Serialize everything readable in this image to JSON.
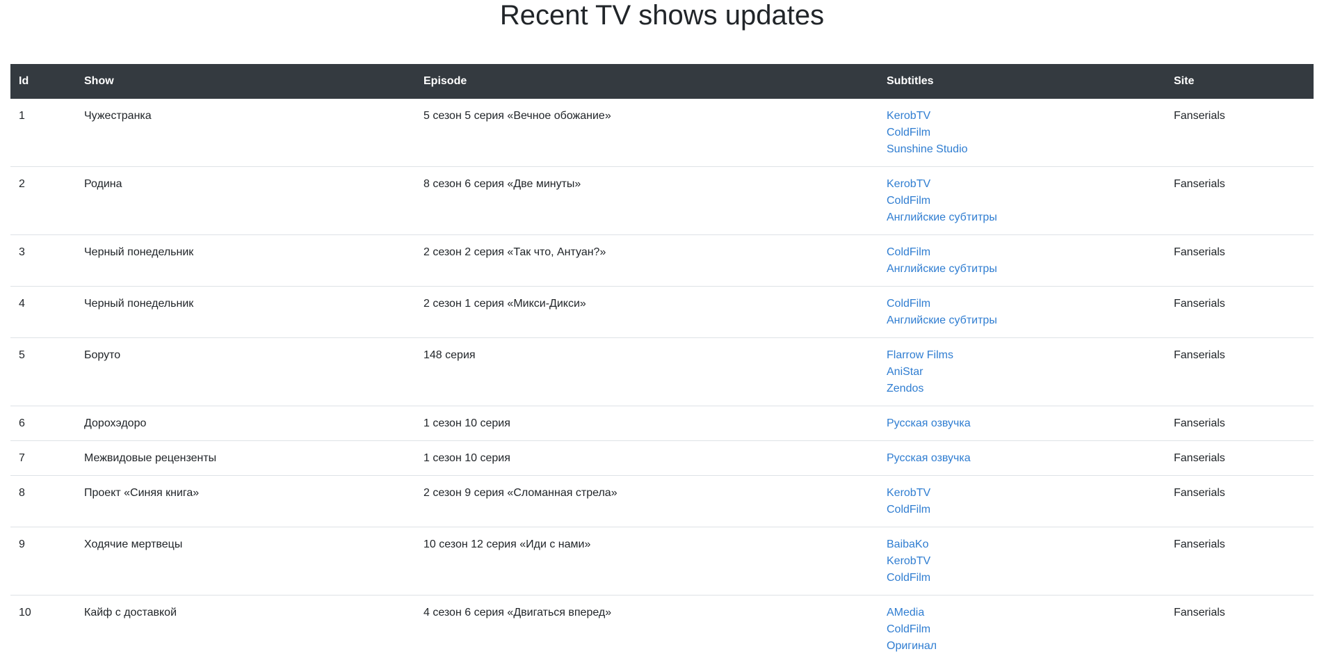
{
  "page": {
    "title": "Recent TV shows updates"
  },
  "colors": {
    "header_bg": "#343a40",
    "link": "#2f7dd1",
    "text": "#212529",
    "row_divider": "#dee2e6"
  },
  "table": {
    "headers": {
      "id": "Id",
      "show": "Show",
      "episode": "Episode",
      "subtitles": "Subtitles",
      "site": "Site"
    },
    "rows": [
      {
        "id": "1",
        "show": "Чужестранка",
        "episode": "5 сезон 5 серия «Вечное обожание»",
        "subtitles": [
          "KerobTV",
          "ColdFilm",
          "Sunshine Studio"
        ],
        "site": "Fanserials"
      },
      {
        "id": "2",
        "show": "Родина",
        "episode": "8 сезон 6 серия «Две минуты»",
        "subtitles": [
          "KerobTV",
          "ColdFilm",
          "Английские субтитры"
        ],
        "site": "Fanserials"
      },
      {
        "id": "3",
        "show": "Черный понедельник",
        "episode": "2 сезон 2 серия «Так что, Антуан?»",
        "subtitles": [
          "ColdFilm",
          "Английские субтитры"
        ],
        "site": "Fanserials"
      },
      {
        "id": "4",
        "show": "Черный понедельник",
        "episode": "2 сезон 1 серия «Микси-Дикси»",
        "subtitles": [
          "ColdFilm",
          "Английские субтитры"
        ],
        "site": "Fanserials"
      },
      {
        "id": "5",
        "show": "Боруто",
        "episode": "148 серия",
        "subtitles": [
          "Flarrow Films",
          "AniStar",
          "Zendos"
        ],
        "site": "Fanserials"
      },
      {
        "id": "6",
        "show": "Дорохэдоро",
        "episode": "1 сезон 10 серия",
        "subtitles": [
          "Русская озвучка"
        ],
        "site": "Fanserials"
      },
      {
        "id": "7",
        "show": "Межвидовые рецензенты",
        "episode": "1 сезон 10 серия",
        "subtitles": [
          "Русская озвучка"
        ],
        "site": "Fanserials"
      },
      {
        "id": "8",
        "show": "Проект «Синяя книга»",
        "episode": "2 сезон 9 серия «Сломанная стрела»",
        "subtitles": [
          "KerobTV",
          "ColdFilm"
        ],
        "site": "Fanserials"
      },
      {
        "id": "9",
        "show": "Ходячие мертвецы",
        "episode": "10 сезон 12 серия «Иди с нами»",
        "subtitles": [
          "BaibaKo",
          "KerobTV",
          "ColdFilm"
        ],
        "site": "Fanserials"
      },
      {
        "id": "10",
        "show": "Кайф с доставкой",
        "episode": "4 сезон 6 серия «Двигаться вперед»",
        "subtitles": [
          "AMedia",
          "ColdFilm",
          "Оригинал"
        ],
        "site": "Fanserials"
      }
    ]
  }
}
